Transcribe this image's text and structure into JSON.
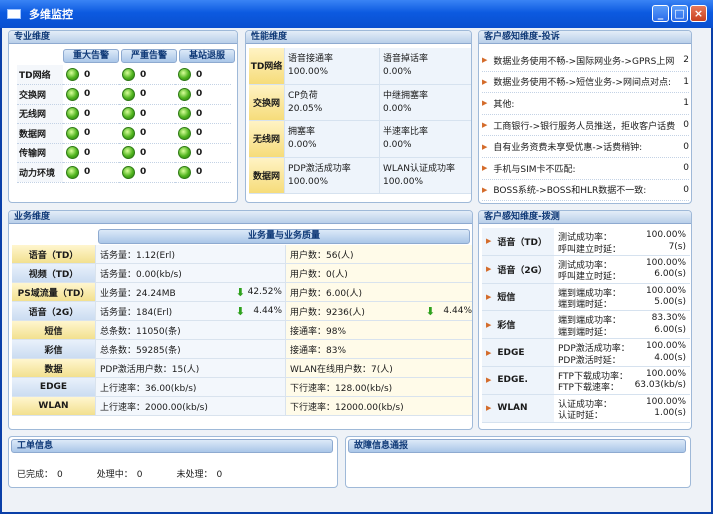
{
  "window": {
    "title": "多维监控",
    "buttons": [
      "_",
      "□",
      "×"
    ]
  },
  "professional": {
    "title": "专业维度",
    "headers": [
      "重大告警",
      "严重告警",
      "基站退服"
    ],
    "rows": [
      {
        "label": "TD网络",
        "values": [
          "0",
          "0",
          "0"
        ]
      },
      {
        "label": "交换网",
        "values": [
          "0",
          "0",
          "0"
        ]
      },
      {
        "label": "无线网",
        "values": [
          "0",
          "0",
          "0"
        ]
      },
      {
        "label": "数据网",
        "values": [
          "0",
          "0",
          "0"
        ]
      },
      {
        "label": "传输网",
        "values": [
          "0",
          "0",
          "0"
        ]
      },
      {
        "label": "动力环境",
        "values": [
          "0",
          "0",
          "0"
        ]
      }
    ]
  },
  "performance": {
    "title": "性能维度",
    "rows": [
      {
        "label": "TD网络",
        "a_name": "语音接通率",
        "a_val": "100.00%",
        "b_name": "语音掉话率",
        "b_val": "0.00%"
      },
      {
        "label": "交换网",
        "a_name": "CP负荷",
        "a_val": "20.05%",
        "b_name": "中继拥塞率",
        "b_val": "0.00%"
      },
      {
        "label": "无线网",
        "a_name": "拥塞率",
        "a_val": "0.00%",
        "b_name": "半速率比率",
        "b_val": "0.00%"
      },
      {
        "label": "数据网",
        "a_name": "PDP激活成功率",
        "a_val": "100.00%",
        "b_name": "WLAN认证成功率",
        "b_val": "100.00%"
      }
    ]
  },
  "complaints": {
    "title": "客户感知维度-投诉",
    "items": [
      {
        "text": "数据业务使用不畅->国际网业务->GPRS上网:",
        "count": "2"
      },
      {
        "text": "数据业务使用不畅->短信业务->网间点对点:",
        "count": "1"
      },
      {
        "text": "其他:",
        "count": "1"
      },
      {
        "text": "工商银行->银行服务人员推送，拒收客户话费:",
        "count": "0"
      },
      {
        "text": "自有业务资费未享受优惠->话费稍钟:",
        "count": "0"
      },
      {
        "text": "手机与SIM卡不匹配:",
        "count": "0"
      },
      {
        "text": "BOSS系统->BOSS和HLR数据不一致:",
        "count": "0"
      }
    ]
  },
  "business": {
    "title": "业务维度",
    "header": "业务量与业务质量",
    "rows": [
      {
        "label": "语音（TD）",
        "style": "yellow",
        "c1": "话务量：1.12(Erl)",
        "c1_pct": "",
        "c2": "用户数：56(人)",
        "c2_pct": ""
      },
      {
        "label": "视频（TD）",
        "style": "blue",
        "c1": "话务量：0.00(kb/s)",
        "c1_pct": "",
        "c2": "用户数：0(人)",
        "c2_pct": ""
      },
      {
        "label": "PS域流量（TD）",
        "style": "yellow",
        "c1": "业务量：24.24MB",
        "c1_pct": "42.52%",
        "c2": "用户数：6.00(人)",
        "c2_pct": ""
      },
      {
        "label": "语音（2G）",
        "style": "blue",
        "c1": "话务量：184(Erl)",
        "c1_pct": "4.44%",
        "c2": "用户数：9236(人)",
        "c2_pct": "4.44%"
      },
      {
        "label": "短信",
        "style": "yellow",
        "c1": "总条数：11050(条)",
        "c1_pct": "",
        "c2": "接通率：98%",
        "c2_pct": ""
      },
      {
        "label": "彩信",
        "style": "blue",
        "c1": "总条数：59285(条)",
        "c1_pct": "",
        "c2": "接通率：83%",
        "c2_pct": ""
      },
      {
        "label": "数据",
        "style": "yellow",
        "c1": "PDP激活用户数：15(人)",
        "c1_pct": "",
        "c2": "WLAN在线用户数：7(人)",
        "c2_pct": ""
      },
      {
        "label": "EDGE",
        "style": "blue",
        "c1": "上行速率：36.00(kb/s)",
        "c1_pct": "",
        "c2": "下行速率：128.00(kb/s)",
        "c2_pct": ""
      },
      {
        "label": "WLAN",
        "style": "yellow",
        "c1": "上行速率：2000.00(kb/s)",
        "c1_pct": "",
        "c2": "下行速率：12000.00(kb/s)",
        "c2_pct": ""
      }
    ]
  },
  "dialtest": {
    "title": "客户感知维度-拨测",
    "rows": [
      {
        "label": "语音（TD）",
        "l1": "测试成功率：",
        "v1": "100.00%",
        "l2": "呼叫建立时延：",
        "v2": "7(s)"
      },
      {
        "label": "语音（2G）",
        "l1": "测试成功率：",
        "v1": "100.00%",
        "l2": "呼叫建立时延：",
        "v2": "6.00(s)"
      },
      {
        "label": "短信",
        "l1": "端到端成功率：",
        "v1": "100.00%",
        "l2": "端到端时延：",
        "v2": "5.00(s)"
      },
      {
        "label": "彩信",
        "l1": "端到端成功率：",
        "v1": "83.30%",
        "l2": "端到端时延：",
        "v2": "6.00(s)"
      },
      {
        "label": "EDGE",
        "l1": "PDP激活成功率：",
        "v1": "100.00%",
        "l2": "PDP激活时延：",
        "v2": "4.00(s)"
      },
      {
        "label": "EDGE.",
        "l1": "FTP下载成功率：",
        "v1": "100.00%",
        "l2": "FTP下载速率：",
        "v2": "63.03(kb/s)"
      },
      {
        "label": "WLAN",
        "l1": "认证成功率：",
        "v1": "100.00%",
        "l2": "认证时延：",
        "v2": "1.00(s)"
      }
    ]
  },
  "workorder": {
    "title": "工单信息",
    "done_label": "已完成：",
    "done": "0",
    "doing_label": "处理中：",
    "doing": "0",
    "todo_label": "未处理：",
    "todo": "0"
  },
  "fault": {
    "title": "故障信息通报"
  }
}
